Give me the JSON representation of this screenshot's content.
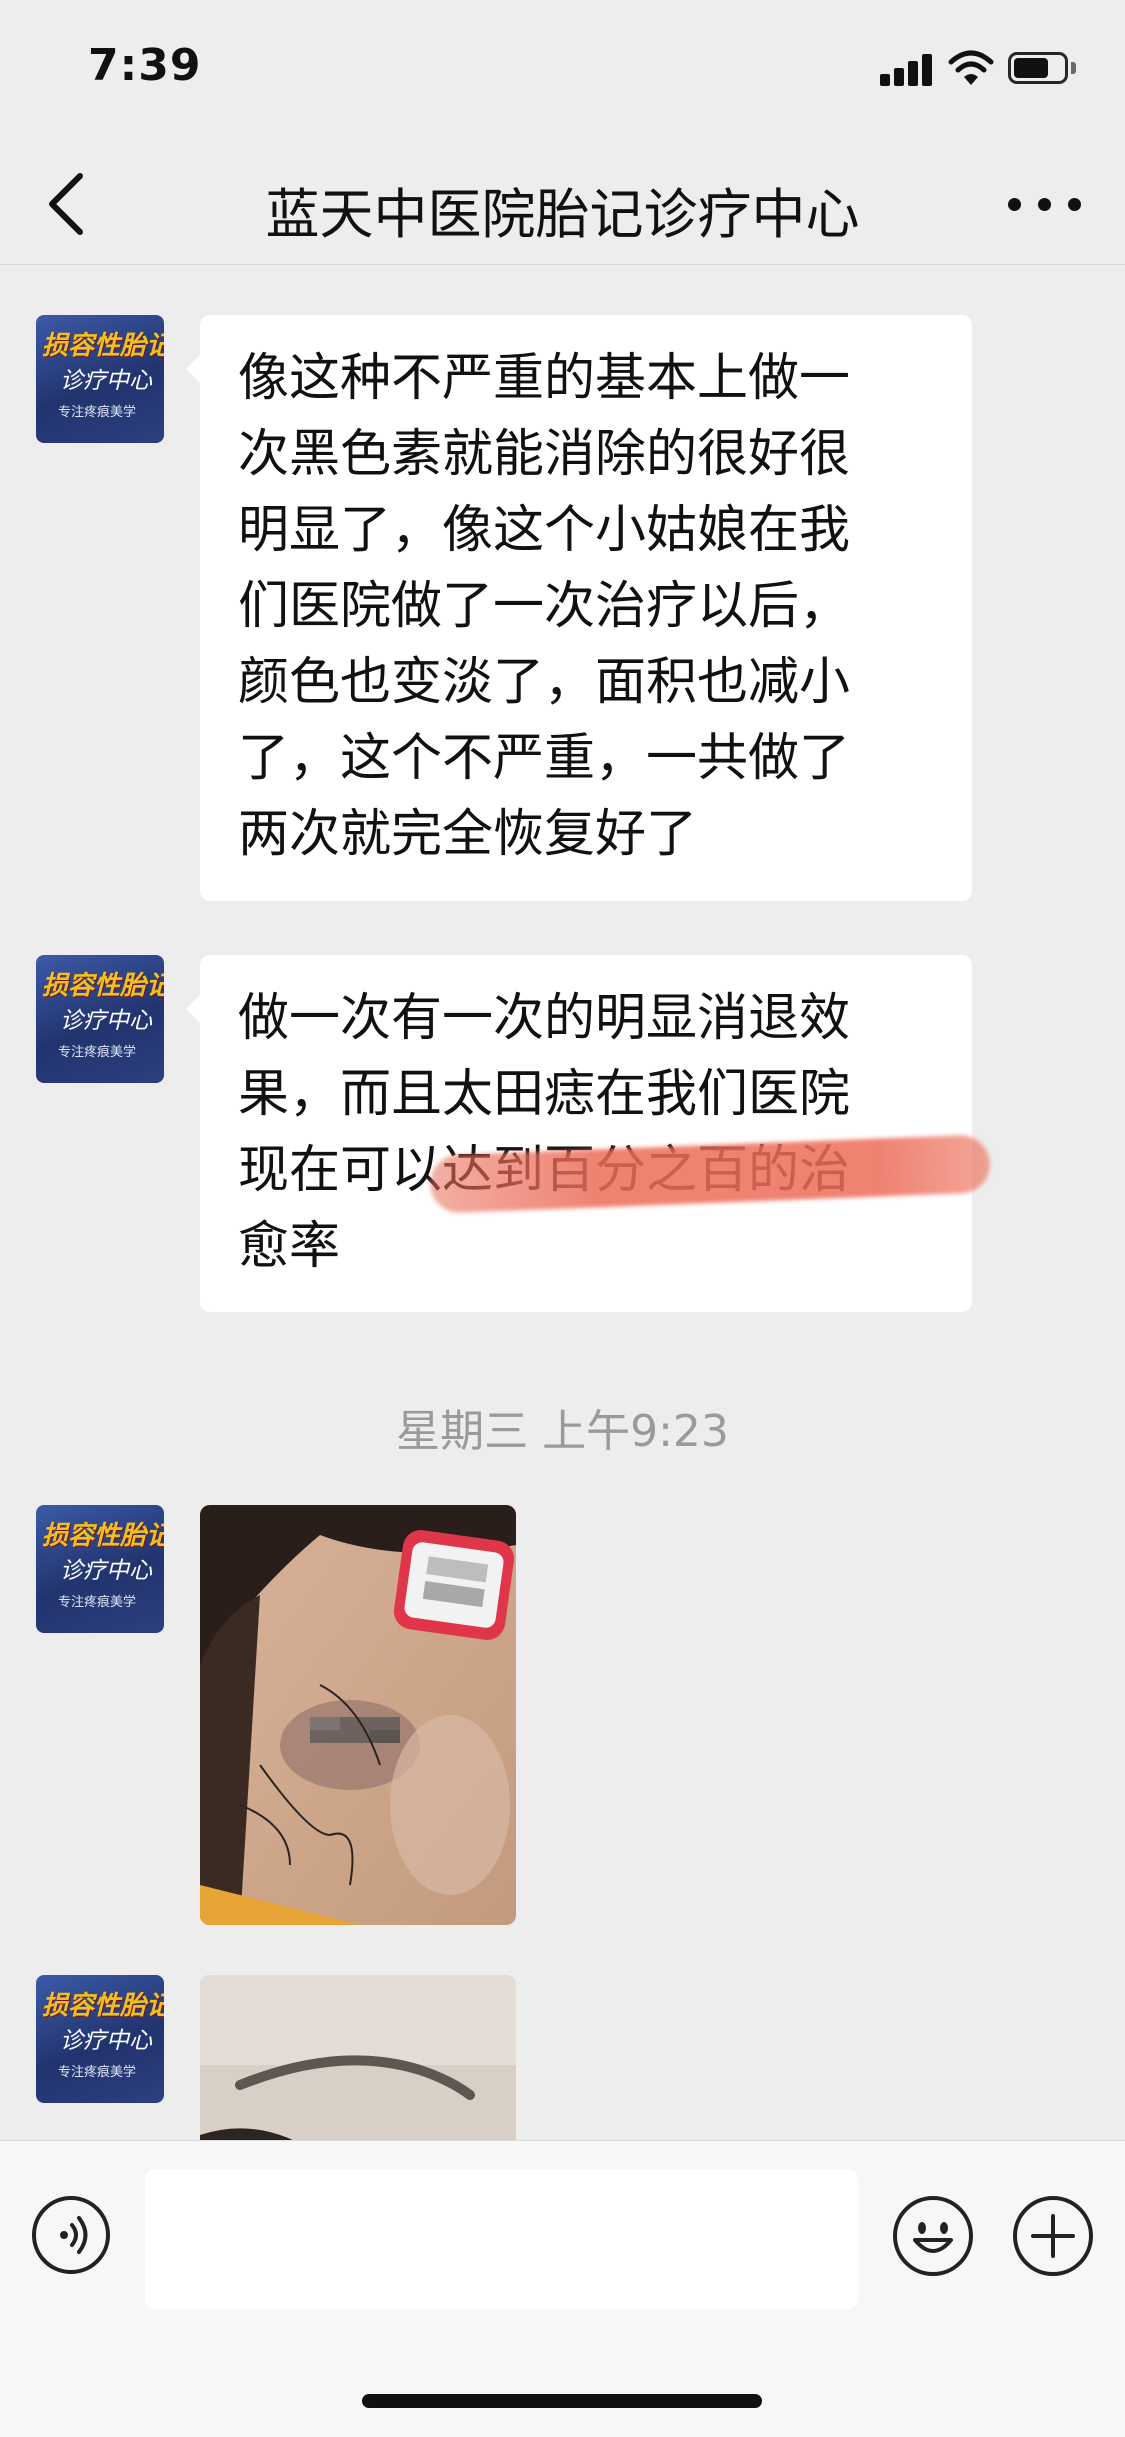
{
  "status_bar": {
    "time": "7:39"
  },
  "header": {
    "title": "蓝天中医院胎记诊疗中心"
  },
  "avatar": {
    "line1": "损容性胎记",
    "line2": "诊疗中心",
    "line3": "专注疼痕美学"
  },
  "messages": [
    {
      "type": "text",
      "text": "像这种不严重的基本上做一\n次黑色素就能消除的很好很\n明显了，像这个小姑娘在我\n们医院做了一次治疗以后，\n颜色也变淡了，面积也减小\n了，这个不严重，一共做了\n两次就完全恢复好了"
    },
    {
      "type": "text",
      "text": "做一次有一次的明显消退效\n果，而且太田痣在我们医院\n现在可以达到百分之百的治\n愈率"
    },
    {
      "type": "timestamp",
      "text": "星期三 上午9:23"
    },
    {
      "type": "image"
    },
    {
      "type": "image"
    }
  ],
  "input_bar": {
    "placeholder": ""
  },
  "colors": {
    "background": "#ededed",
    "bubble": "#ffffff",
    "highlight": "#ec6c58",
    "input_bar": "#f7f7f7"
  }
}
